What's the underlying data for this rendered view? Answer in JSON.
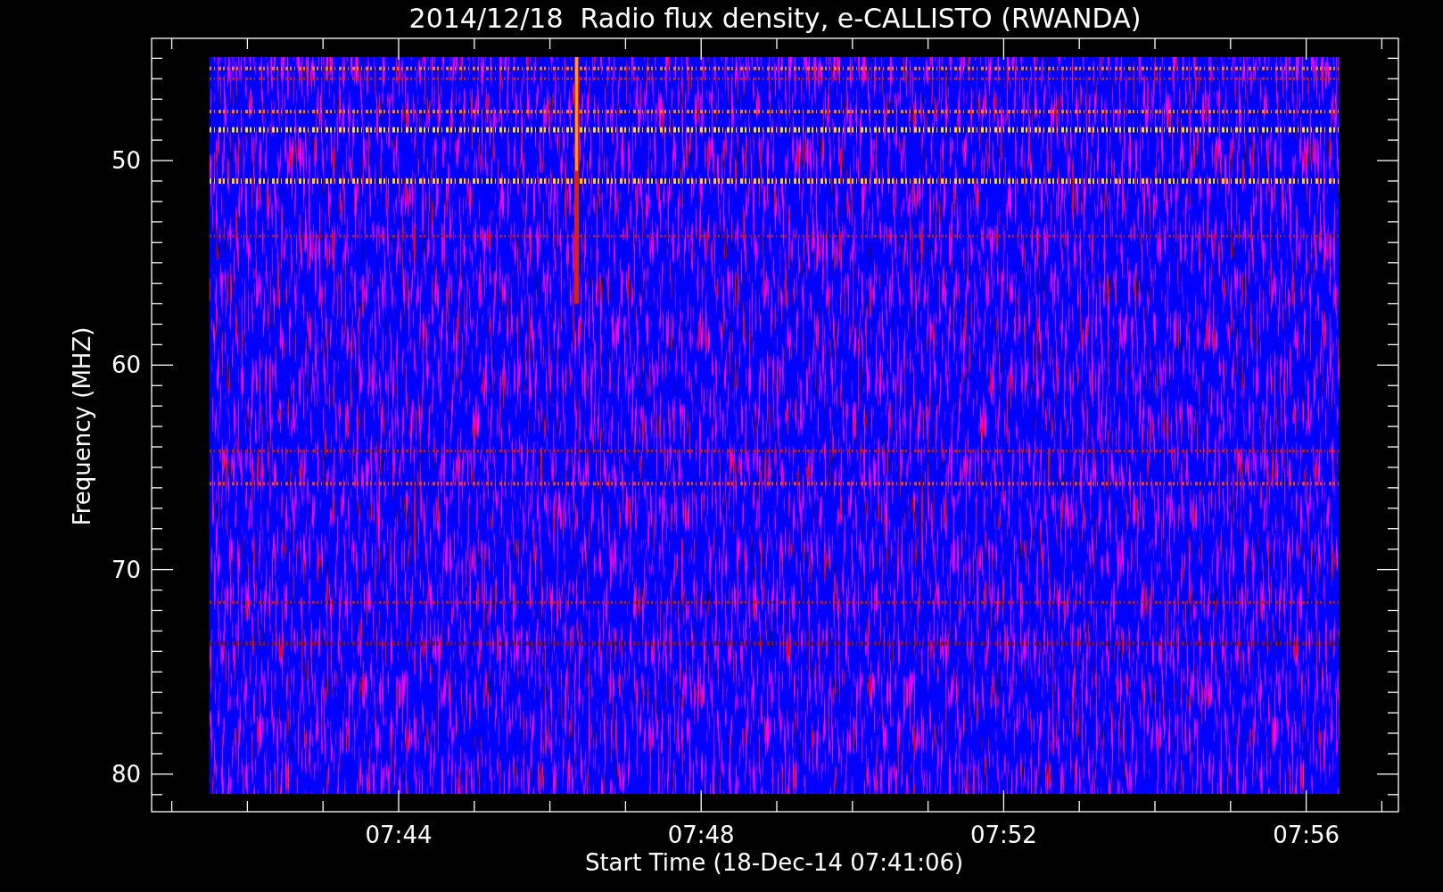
{
  "plot": {
    "title": "2014/12/18  Radio flux density, e-CALLISTO (RWANDA)",
    "ylabel": "Frequency (MHZ)",
    "xlabel": "Start Time (18-Dec-14 07:41:06)",
    "y_tick_labels": [
      "50",
      "60",
      "70",
      "80"
    ],
    "x_tick_labels": [
      "07:44",
      "07:48",
      "07:52",
      "07:56"
    ]
  }
}
